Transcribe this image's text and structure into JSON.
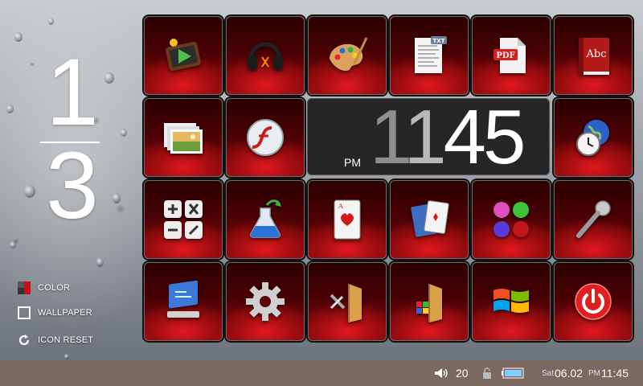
{
  "page_indicator": {
    "current": "1",
    "total": "3"
  },
  "side_menu": {
    "color_label": "COLOR",
    "wallpaper_label": "WALLPAPER",
    "icon_reset_label": "ICON RESET"
  },
  "clock_widget": {
    "ampm": "PM",
    "hour_1": "1",
    "hour_2": "1",
    "minutes": "45"
  },
  "status_bar": {
    "volume": "20",
    "day": "Sat",
    "date": "06.02",
    "ampm": "PM",
    "time": "11:45"
  },
  "tiles": [
    {
      "icon": "video-player-icon"
    },
    {
      "icon": "music-headphones-icon"
    },
    {
      "icon": "paint-palette-icon"
    },
    {
      "icon": "txt-document-icon",
      "badge": "TXT"
    },
    {
      "icon": "pdf-document-icon",
      "badge": "PDF"
    },
    {
      "icon": "dictionary-book-icon",
      "badge": "Abc"
    },
    {
      "icon": "photo-gallery-icon"
    },
    {
      "icon": "flash-player-icon"
    },
    {
      "icon": "world-clock-icon"
    },
    {
      "icon": "calculator-icon"
    },
    {
      "icon": "science-flask-icon"
    },
    {
      "icon": "playing-card-icon"
    },
    {
      "icon": "card-games-icon"
    },
    {
      "icon": "bubble-game-icon"
    },
    {
      "icon": "microphone-icon"
    },
    {
      "icon": "control-panel-icon"
    },
    {
      "icon": "settings-gear-icon"
    },
    {
      "icon": "tools-folder-icon"
    },
    {
      "icon": "programs-folder-icon"
    },
    {
      "icon": "windows-logo-icon"
    },
    {
      "icon": "power-button-icon"
    }
  ],
  "colors": {
    "tile_red": "#e0191e",
    "status_bar": "#7b6861",
    "clock_bg": "#262626"
  }
}
